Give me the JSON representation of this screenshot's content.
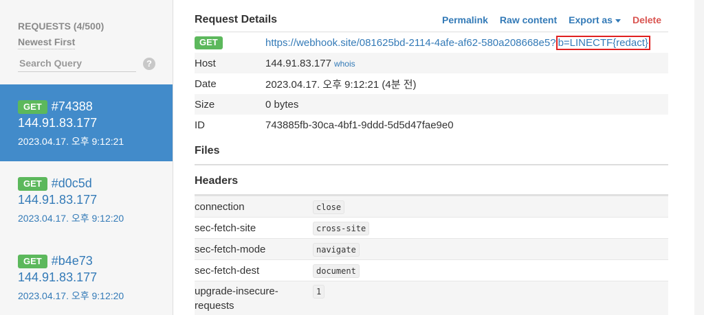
{
  "sidebar": {
    "title": "REQUESTS (4/500)",
    "sort": "Newest First",
    "search_placeholder": "Search Query",
    "requests": [
      {
        "method": "GET",
        "id": "#74388",
        "ip": "144.91.83.177",
        "date": "2023.04.17. 오후 9:12:21"
      },
      {
        "method": "GET",
        "id": "#d0c5d",
        "ip": "144.91.83.177",
        "date": "2023.04.17. 오후 9:12:20"
      },
      {
        "method": "GET",
        "id": "#b4e73",
        "ip": "144.91.83.177",
        "date": "2023.04.17. 오후 9:12:20"
      }
    ]
  },
  "details": {
    "title": "Request Details",
    "links": {
      "permalink": "Permalink",
      "raw": "Raw content",
      "export": "Export as",
      "delete": "Delete"
    },
    "method": "GET",
    "url_base": "https://webhook.site/081625bd-2114-4afe-af62-580a208668e5?",
    "url_query": "b=LINECTF{redact}",
    "rows": {
      "host_label": "Host",
      "host": "144.91.83.177",
      "whois": "whois",
      "date_label": "Date",
      "date": "2023.04.17. 오후 9:12:21 (4분 전)",
      "size_label": "Size",
      "size": "0 bytes",
      "id_label": "ID",
      "id": "743885fb-30ca-4bf1-9ddd-5d5d47fae9e0"
    }
  },
  "files": {
    "title": "Files"
  },
  "headers": {
    "title": "Headers",
    "rows": [
      {
        "name": "connection",
        "value": "close"
      },
      {
        "name": "sec-fetch-site",
        "value": "cross-site"
      },
      {
        "name": "sec-fetch-mode",
        "value": "navigate"
      },
      {
        "name": "sec-fetch-dest",
        "value": "document"
      },
      {
        "name": "upgrade-insecure-requests",
        "value": "1"
      }
    ]
  },
  "colors": {
    "active": "#428bca",
    "get_badge": "#5cb85c",
    "link": "#337ab7",
    "delete": "#d9534f",
    "highlight": "#e02020"
  }
}
